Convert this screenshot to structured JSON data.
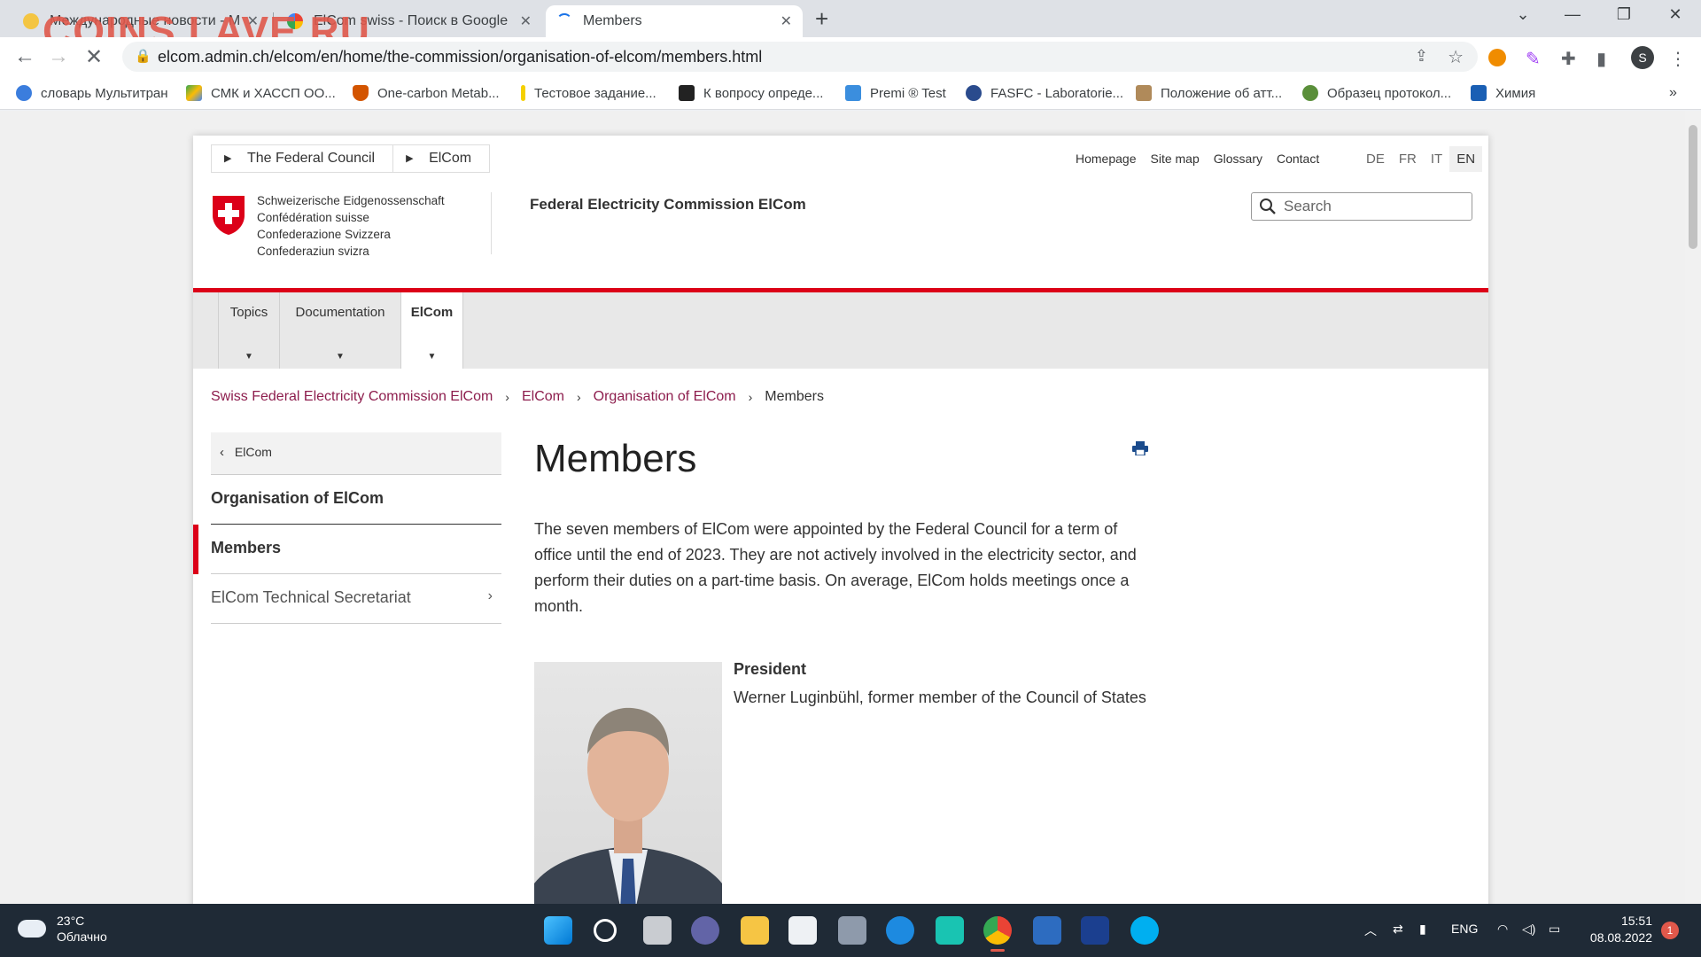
{
  "browser": {
    "tabs": [
      {
        "label": "Международные новости - Мо",
        "active": false
      },
      {
        "label": "ElCom swiss - Поиск в Google",
        "active": false
      },
      {
        "label": "Members",
        "active": true
      }
    ],
    "url": "elcom.admin.ch/elcom/en/home/the-commission/organisation-of-elcom/members.html",
    "watermark": "COINS.LAVE.RU",
    "profile_initial": "S",
    "bookmarks": [
      "словарь Мультитран",
      "СМК и ХАССП ОО...",
      "One-carbon Metab...",
      "Тестовое задание...",
      "К вопросу опреде...",
      "Premi ® Test",
      "FASFC - Laboratorie...",
      "Положение об атт...",
      "Образец протокол...",
      "Химия"
    ]
  },
  "site": {
    "top_breadcrumb": [
      "The Federal Council",
      "ElCom"
    ],
    "meta_links": [
      "Homepage",
      "Site map",
      "Glossary",
      "Contact"
    ],
    "languages": [
      "DE",
      "FR",
      "IT",
      "EN"
    ],
    "active_language": "EN",
    "confederation_names": [
      "Schweizerische Eidgenossenschaft",
      "Confédération suisse",
      "Confederazione Svizzera",
      "Confederaziun svizra"
    ],
    "header_title": "Federal Electricity Commission ElCom",
    "search_placeholder": "Search",
    "main_nav": [
      "Topics",
      "Documentation",
      "ElCom"
    ],
    "breadcrumb": [
      "Swiss Federal Electricity Commission ElCom",
      "ElCom",
      "Organisation of ElCom",
      "Members"
    ],
    "sidenav": {
      "back": "ElCom",
      "heading": "Organisation of ElCom",
      "items": [
        "Members",
        "ElCom Technical Secretariat"
      ]
    },
    "page_title": "Members",
    "intro": "The seven members of ElCom were appointed by the Federal Council for a term of office until the end of 2023. They are not actively involved in the electricity sector, and perform their duties on a part-time basis. On average, ElCom holds meetings once a month.",
    "member": {
      "role": "President",
      "name": "Werner Luginbühl, former member of the Council of States"
    }
  },
  "taskbar": {
    "temperature": "23°C",
    "weather": "Облачно",
    "language": "ENG",
    "time": "15:51",
    "date": "08.08.2022",
    "notifications": "1"
  },
  "colors": {
    "swiss_red": "#dc0018",
    "link": "#8d1d4d"
  }
}
